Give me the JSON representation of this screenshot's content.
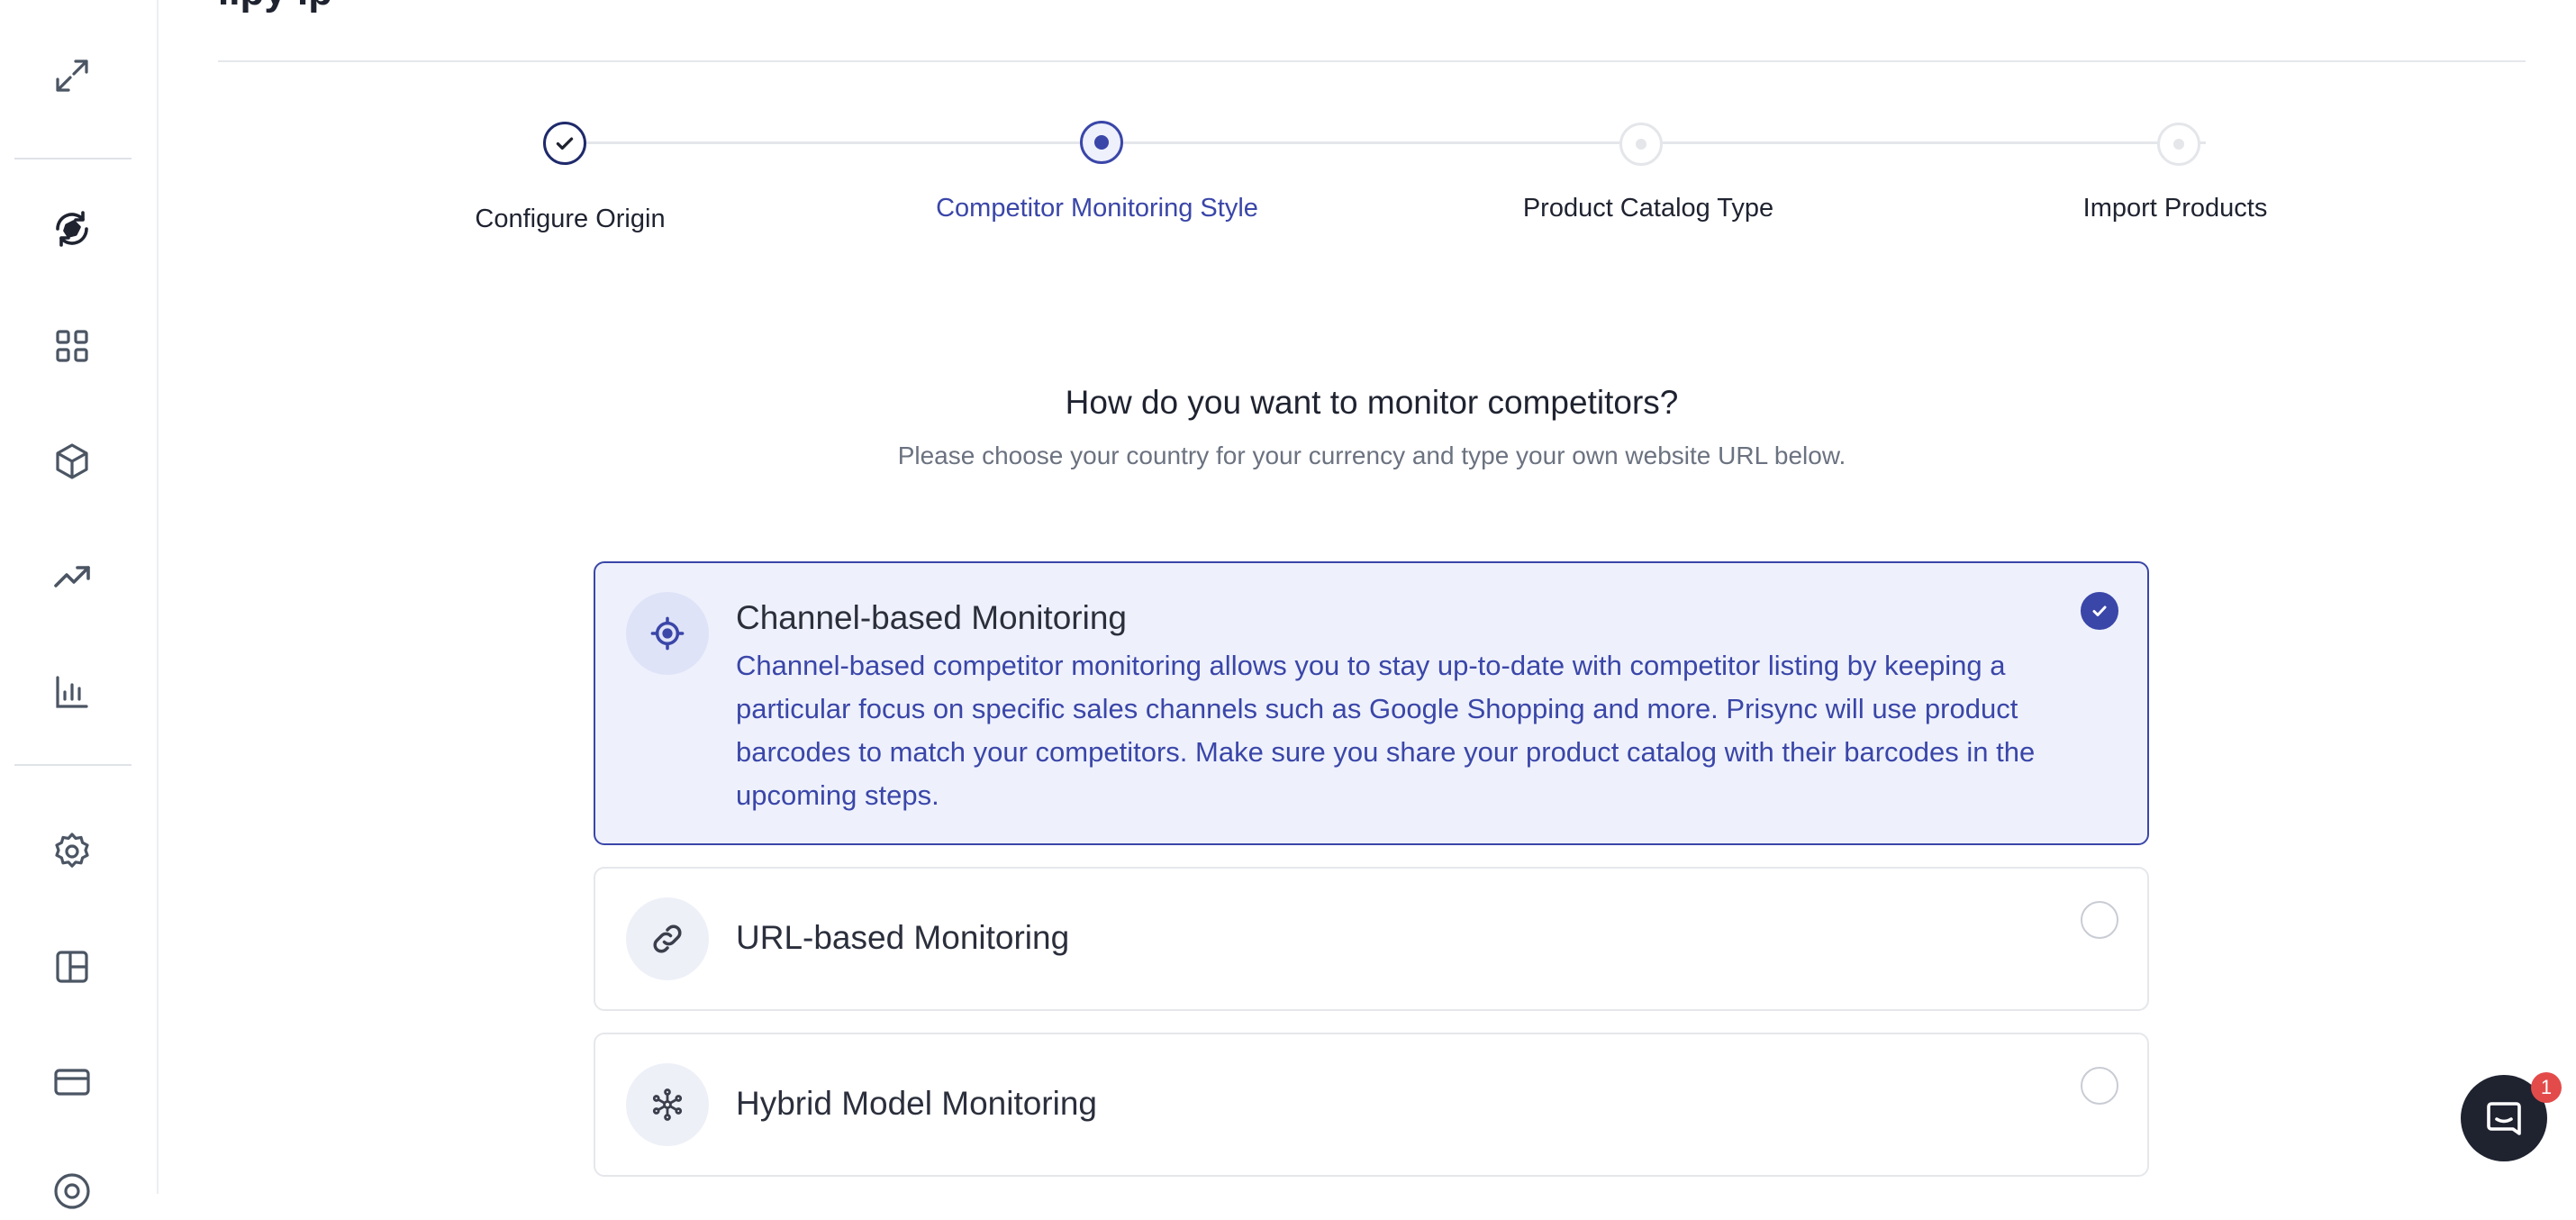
{
  "header": {
    "title_partial": "..py .p"
  },
  "sidebar": {
    "icons": [
      "expand-icon",
      "price-tag-sync-icon",
      "dashboard-grid-icon",
      "products-box-icon",
      "trend-up-icon",
      "bar-chart-icon",
      "settings-gear-icon",
      "layout-panels-icon",
      "credit-card-icon",
      "help-icon"
    ]
  },
  "stepper": {
    "steps": [
      {
        "label": "Configure Origin",
        "state": "completed"
      },
      {
        "label": "Competitor Monitoring Style",
        "state": "active"
      },
      {
        "label": "Product Catalog Type",
        "state": "pending"
      },
      {
        "label": "Import Products",
        "state": "pending"
      }
    ]
  },
  "question": {
    "title": "How do you want to monitor competitors?",
    "subtitle": "Please choose your country for your currency and type your own website URL below."
  },
  "options": [
    {
      "title": "Channel-based Monitoring",
      "description": "Channel-based competitor monitoring allows you to stay up-to-date with competitor listing by keeping a particular focus on specific sales channels such as Google Shopping and more. Prisync will use product barcodes to match your competitors. Make sure you share your product catalog with their barcodes in the upcoming steps.",
      "icon": "target-icon",
      "selected": true
    },
    {
      "title": "URL-based Monitoring",
      "icon": "link-icon",
      "selected": false
    },
    {
      "title": "Hybrid Model Monitoring",
      "icon": "hybrid-network-icon",
      "selected": false
    }
  ],
  "chat": {
    "badge_count": "1"
  },
  "colors": {
    "accent": "#3a46a8",
    "selected_bg": "#eef1fc",
    "badge": "#e34b4b"
  }
}
